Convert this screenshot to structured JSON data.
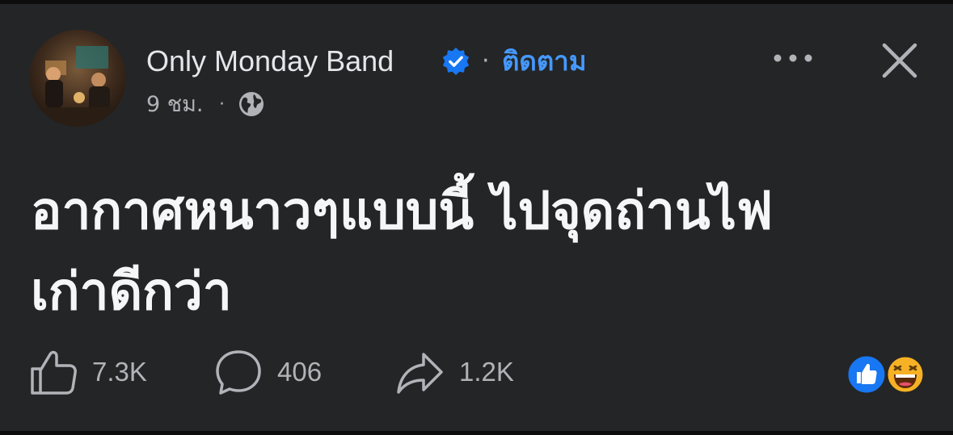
{
  "post": {
    "author": {
      "name": "Only Monday Band",
      "verified": true,
      "follow_label": "ติดตาม"
    },
    "time": "9 ชม.",
    "separator": "·",
    "audience_icon": "globe-icon",
    "text_line1": "อากาศหนาวๆแบบนี้ ไปจุดถ่านไฟ",
    "text_line2": "เก่าดีกว่า"
  },
  "actions": {
    "like_count": "7.3K",
    "comment_count": "406",
    "share_count": "1.2K"
  },
  "reactions": [
    "like",
    "haha"
  ],
  "icons": {
    "verified": "verified-badge-icon",
    "more": "more-horizontal-icon",
    "close": "close-icon",
    "like": "thumbs-up-icon",
    "comment": "comment-bubble-icon",
    "share": "share-arrow-icon"
  },
  "colors": {
    "background": "#242526",
    "primary_text": "#e4e6eb",
    "secondary_text": "#b0b3b8",
    "accent_blue": "#4599ff",
    "verified_blue": "#1877f2",
    "haha_yellow": "#f7b125"
  }
}
